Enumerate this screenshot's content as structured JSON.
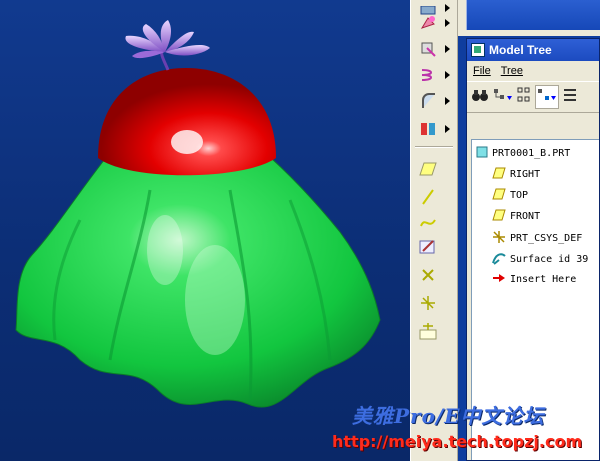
{
  "model_tree": {
    "title": "Model Tree",
    "menu": [
      {
        "label": "File"
      },
      {
        "label": "Tree"
      }
    ],
    "items": [
      {
        "label": "PRT0001_B.PRT",
        "icon": "part-icon"
      },
      {
        "label": "RIGHT",
        "icon": "datum-plane-icon"
      },
      {
        "label": "TOP",
        "icon": "datum-plane-icon"
      },
      {
        "label": "FRONT",
        "icon": "datum-plane-icon"
      },
      {
        "label": "PRT_CSYS_DEF",
        "icon": "coordinate-system-icon"
      },
      {
        "label": "Surface id 39",
        "icon": "surface-icon"
      },
      {
        "label": "Insert Here",
        "icon": "insert-arrow-icon"
      }
    ]
  },
  "watermark": {
    "line1": "美雅Pro/E中文论坛",
    "line2": "http://meiya.tech.topzj.com"
  },
  "colors": {
    "viewport_bg": "#0c2e76",
    "dome": "#e80000",
    "skirt": "#19d64a",
    "flower": "#b07be6",
    "titlebar": "#2456cc",
    "watermark_blue": "#3d6de0",
    "watermark_red": "#ff2b1c"
  }
}
